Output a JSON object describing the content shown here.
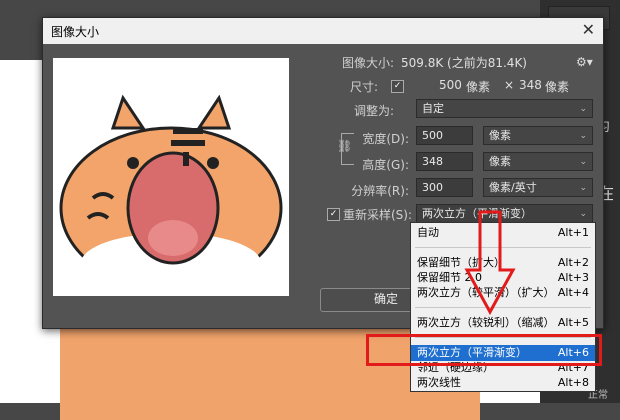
{
  "dialog": {
    "title": "图像大小",
    "close_glyph": "✕",
    "image_size_label": "图像大小:",
    "image_size_value": "509.8K (之前为81.4K)",
    "dimensions_label": "尺寸:",
    "dimensions_width": "500",
    "dimensions_unit1": "像素",
    "dimensions_x": "×",
    "dimensions_height": "348",
    "dimensions_unit2": "像素",
    "fit_label": "调整为:",
    "fit_value": "自定",
    "width_label": "宽度(D):",
    "width_value": "500",
    "width_unit": "像素",
    "height_label": "高度(G):",
    "height_value": "348",
    "height_unit": "像素",
    "resolution_label": "分辨率(R):",
    "resolution_value": "300",
    "resolution_unit": "像素/英寸",
    "resample_label": "重新采样(S):",
    "resample_value": "两次立方（平滑渐变）",
    "ok_label": "确定"
  },
  "dropdown": {
    "items": [
      {
        "label": "自动",
        "shortcut": "Alt+1"
      },
      {
        "label": "保留细节（扩大）",
        "shortcut": "Alt+2"
      },
      {
        "label": "保留细节 2.0",
        "shortcut": "Alt+3"
      },
      {
        "label": "两次立方（较平滑）（扩大）",
        "shortcut": "Alt+4"
      },
      {
        "label": "两次立方（较锐利）（缩减）",
        "shortcut": "Alt+5"
      },
      {
        "label": "两次立方（平滑渐变）",
        "shortcut": "Alt+6",
        "selected": true
      },
      {
        "label": "邻近（硬边缘）",
        "shortcut": "Alt+7"
      },
      {
        "label": "两次线性",
        "shortcut": "Alt+8"
      }
    ]
  },
  "background": {
    "side_text_1": "习",
    "side_text_2": "在",
    "side_text_3": "正常"
  },
  "colors": {
    "highlight": "#e21a1a",
    "selection": "#1e6fcf",
    "tiger_orange": "#f0a36b"
  }
}
